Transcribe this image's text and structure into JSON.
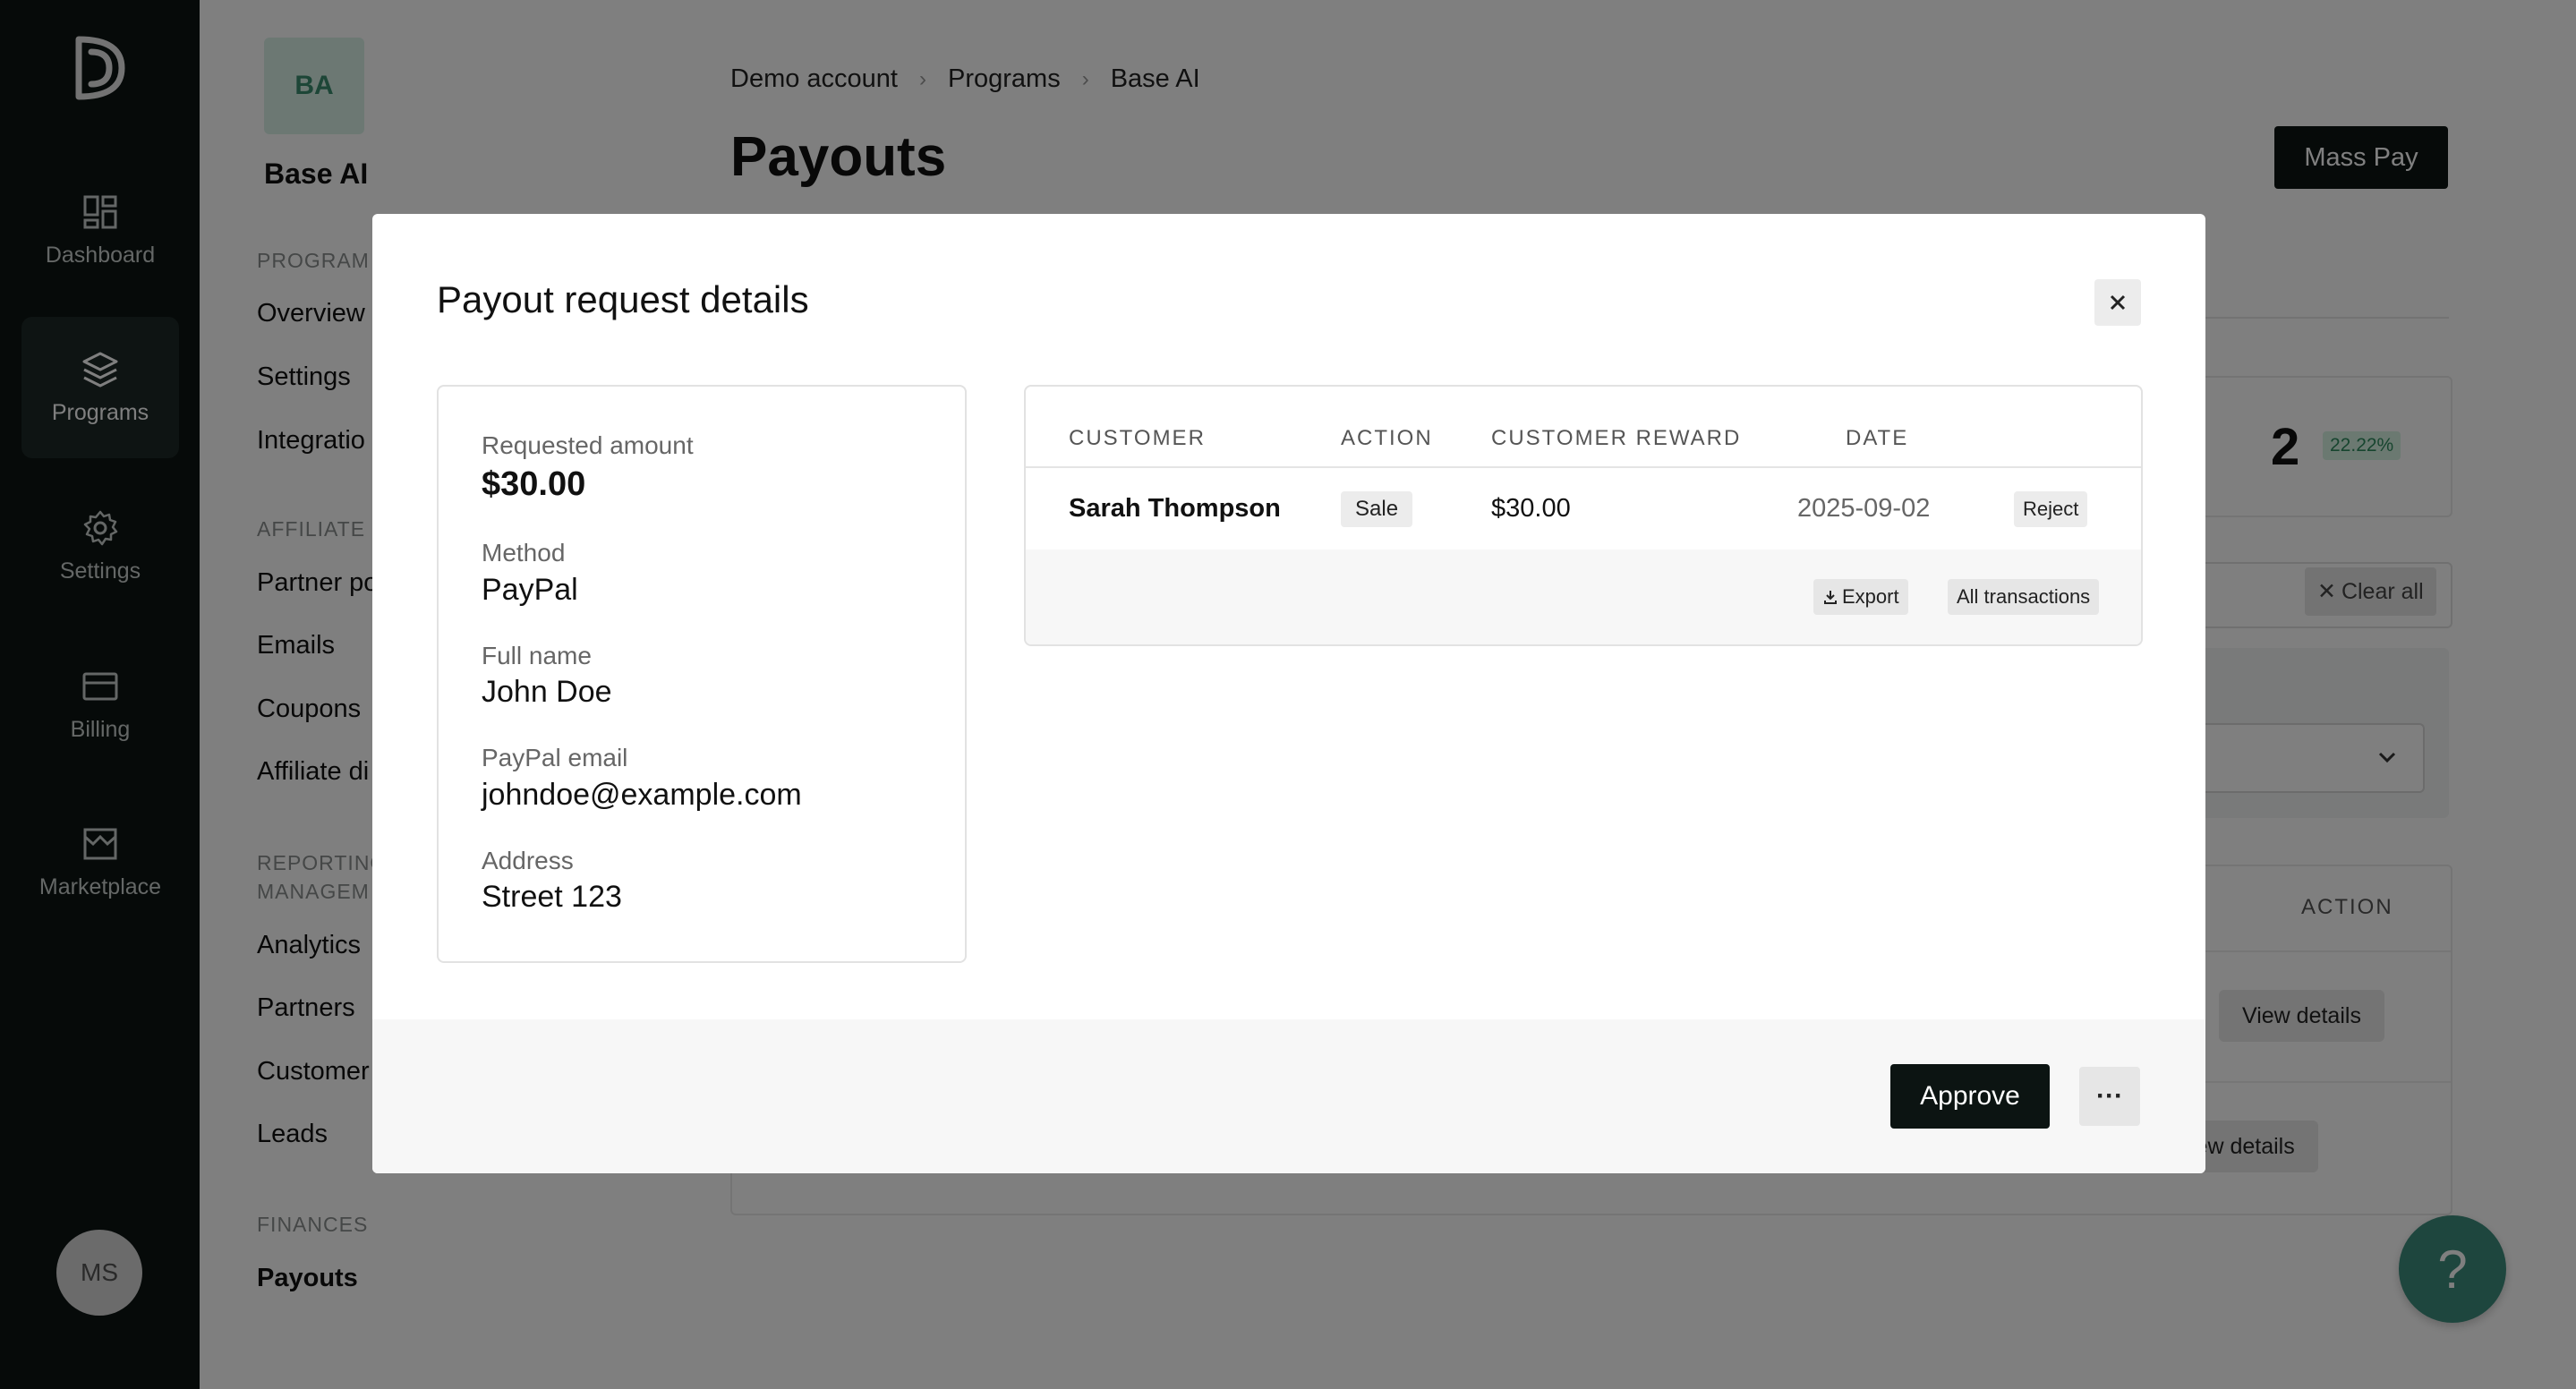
{
  "rail": {
    "items": [
      {
        "label": "Dashboard",
        "icon": "dashboard-icon"
      },
      {
        "label": "Programs",
        "icon": "layers-icon",
        "active": true
      },
      {
        "label": "Settings",
        "icon": "gear-icon"
      },
      {
        "label": "Billing",
        "icon": "card-icon"
      },
      {
        "label": "Marketplace",
        "icon": "store-icon"
      }
    ],
    "avatar_initials": "MS"
  },
  "sidebar": {
    "badge": "BA",
    "program_name": "Base AI",
    "sections": [
      {
        "title": "PROGRAM",
        "items": [
          "Overview",
          "Settings",
          "Integratio"
        ]
      },
      {
        "title": "AFFILIATE",
        "items": [
          "Partner po",
          "Emails",
          "Coupons",
          "Affiliate di"
        ]
      },
      {
        "title_line1": "REPORTING",
        "title_line2": "MANAGEM",
        "items": [
          "Analytics",
          "Partners",
          "Customer",
          "Leads"
        ]
      },
      {
        "title": "FINANCES",
        "items": [
          "Payouts"
        ]
      }
    ]
  },
  "main": {
    "breadcrumbs": [
      "Demo account",
      "Programs",
      "Base AI"
    ],
    "title": "Payouts",
    "mass_pay_label": "Mass Pay",
    "stat_value": "2",
    "stat_percent": "22.22%",
    "clear_all_label": "Clear all",
    "table_action_header": "ACTION",
    "view_details_label": "View details",
    "view_details_partial": "iew details"
  },
  "modal": {
    "title": "Payout request details",
    "details": {
      "requested_amount_label": "Requested amount",
      "requested_amount": "$30.00",
      "method_label": "Method",
      "method": "PayPal",
      "full_name_label": "Full name",
      "full_name": "John Doe",
      "paypal_email_label": "PayPal email",
      "paypal_email": "johndoe@example.com",
      "address_label": "Address",
      "address": "Street 123"
    },
    "transactions": {
      "headers": [
        "CUSTOMER",
        "ACTION",
        "CUSTOMER REWARD",
        "DATE"
      ],
      "rows": [
        {
          "customer": "Sarah Thompson",
          "action": "Sale",
          "reward": "$30.00",
          "date": "2025-09-02",
          "reject_label": "Reject"
        }
      ],
      "export_label": "Export",
      "all_transactions_label": "All transactions"
    },
    "approve_label": "Approve",
    "more_label": "···"
  },
  "help_label": "?",
  "colors": {
    "rail_bg": "#0c1412",
    "accent_green": "#3d8d7d",
    "primary_button": "#0c1412"
  }
}
